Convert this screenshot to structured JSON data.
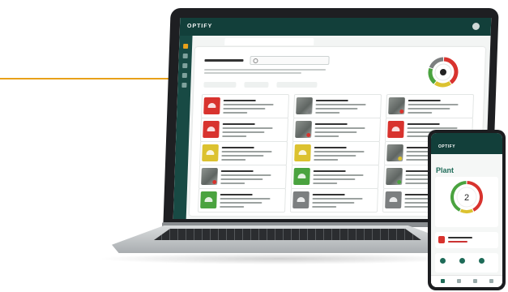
{
  "colors": {
    "accent": "#e8a11a",
    "brand_dark": "#123f3a",
    "status_red": "#d8332e",
    "status_yellow": "#dcc230",
    "status_green": "#4aa33f",
    "status_gray": "#7c7f80"
  },
  "laptop": {
    "brand": "OPTIFY",
    "status_donut": [
      {
        "status": "red",
        "value": 6
      },
      {
        "status": "yellow",
        "value": 3
      },
      {
        "status": "green",
        "value": 3
      },
      {
        "status": "gray",
        "value": 3
      }
    ],
    "cards": [
      {
        "status": "red",
        "thumb": "icon"
      },
      {
        "status": "gray",
        "thumb": "photo"
      },
      {
        "status": "red",
        "thumb": "photo"
      },
      {
        "status": "red",
        "thumb": "icon"
      },
      {
        "status": "red",
        "thumb": "photo"
      },
      {
        "status": "red",
        "thumb": "icon"
      },
      {
        "status": "yellow",
        "thumb": "icon"
      },
      {
        "status": "yellow",
        "thumb": "icon"
      },
      {
        "status": "yellow",
        "thumb": "photo"
      },
      {
        "status": "red",
        "thumb": "photo"
      },
      {
        "status": "green",
        "thumb": "icon"
      },
      {
        "status": "green",
        "thumb": "photo"
      },
      {
        "status": "green",
        "thumb": "icon"
      },
      {
        "status": "gray",
        "thumb": "icon"
      },
      {
        "status": "gray",
        "thumb": "icon"
      }
    ]
  },
  "phone": {
    "brand": "OPTIFY",
    "page_title": "Plant",
    "gauge_value": "2",
    "gauge_segments": [
      {
        "status": "red",
        "value": 3
      },
      {
        "status": "yellow",
        "value": 1
      },
      {
        "status": "green",
        "value": 3
      }
    ]
  }
}
